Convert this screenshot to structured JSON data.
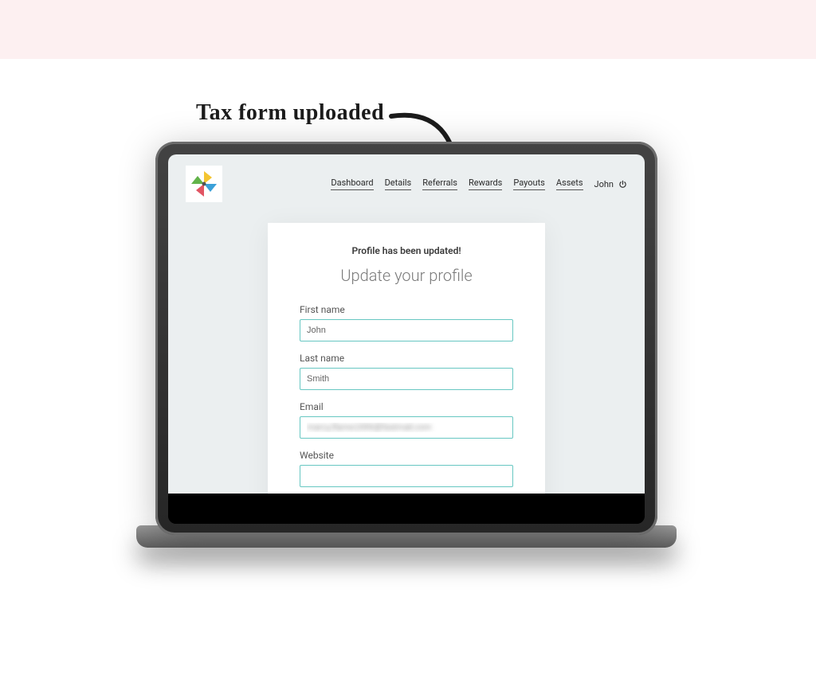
{
  "annotation": "Tax form uploaded",
  "nav": {
    "items": [
      "Dashboard",
      "Details",
      "Referrals",
      "Rewards",
      "Payouts",
      "Assets"
    ],
    "user_name": "John"
  },
  "card": {
    "status_message": "Profile has been updated!",
    "title": "Update your profile",
    "fields": {
      "first_name": {
        "label": "First name",
        "value": "John"
      },
      "last_name": {
        "label": "Last name",
        "value": "Smith"
      },
      "email": {
        "label": "Email",
        "value": "marcy.flame1999@fastmail.com"
      },
      "website": {
        "label": "Website",
        "value": ""
      }
    }
  },
  "colors": {
    "top_band": "#fdf0f1",
    "app_bg": "#ebeff0",
    "input_border": "#67c7c2"
  }
}
